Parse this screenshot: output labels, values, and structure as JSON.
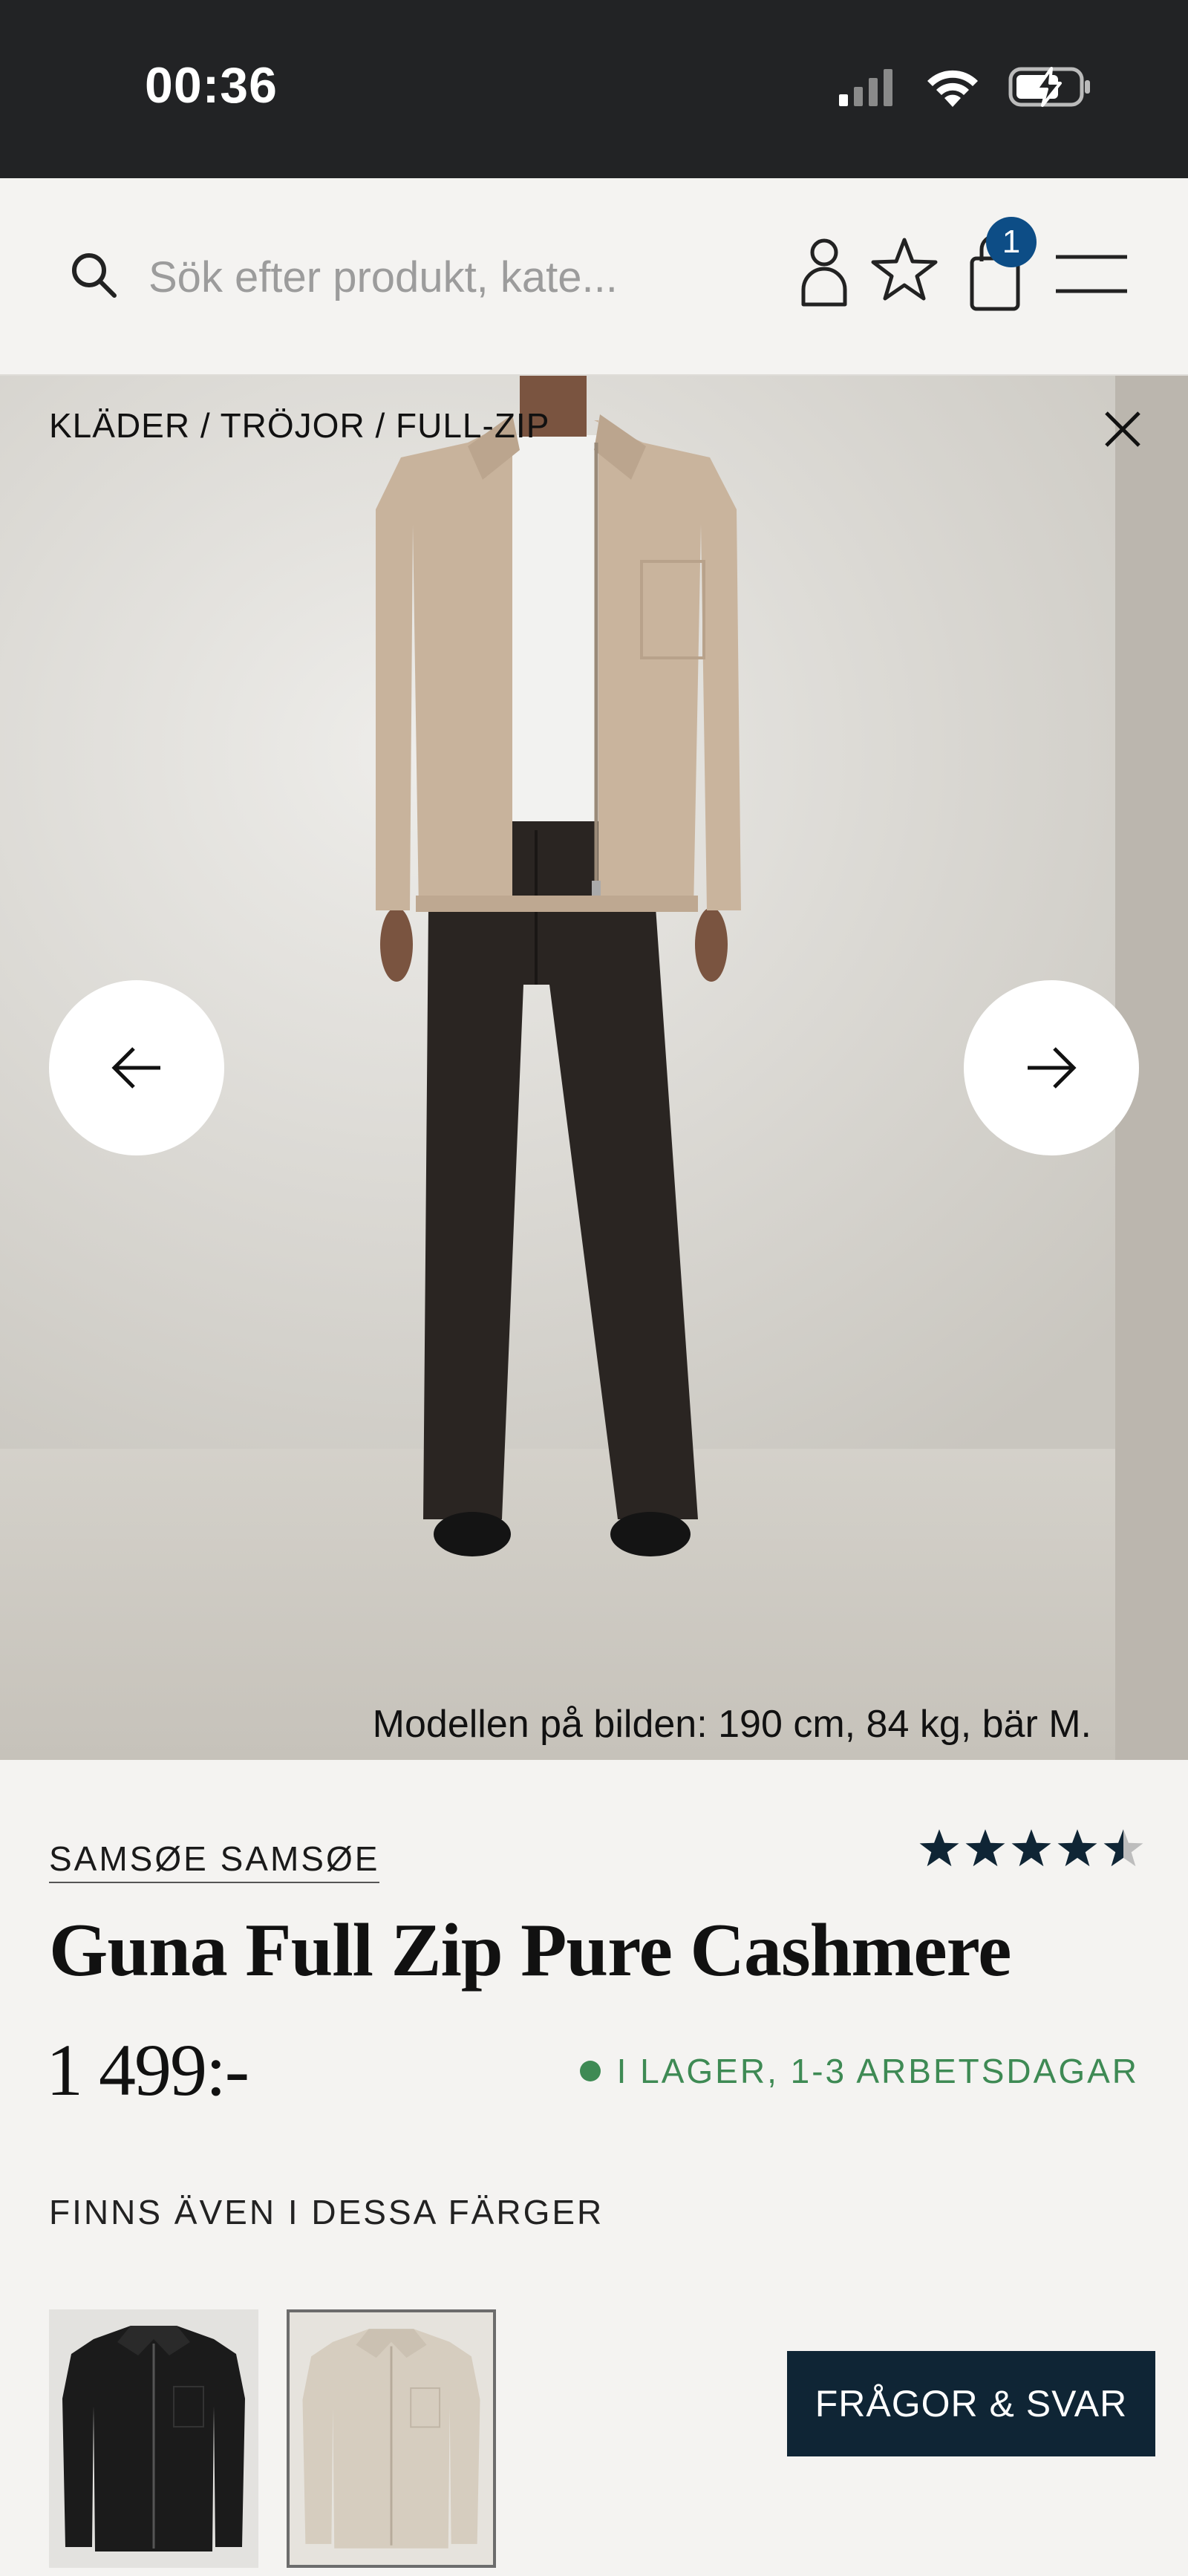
{
  "status_bar": {
    "time": "00:36",
    "icons": [
      "cellular-signal-icon",
      "wifi-icon",
      "battery-charging-icon"
    ]
  },
  "header": {
    "search_placeholder": "Sök efter produkt, kate...",
    "cart_count": "1",
    "icons": [
      "search-icon",
      "account-icon",
      "wishlist-star-icon",
      "shopping-bag-icon",
      "menu-icon"
    ],
    "badge_color": "#0d4d86"
  },
  "hero": {
    "breadcrumb": "KLÄDER / TRÖJOR / FULL-ZIP",
    "model_caption": "Modellen på bilden: 190 cm, 84 kg, bär M."
  },
  "product": {
    "brand": "SAMSØE SAMSØE",
    "title": "Guna Full Zip Pure Cashmere",
    "price": "1 499:-",
    "rating": 4.5,
    "stock_status": "I LAGER, 1-3 ARBETSDAGAR",
    "stock_color": "#3e8a54"
  },
  "colors": {
    "heading": "FINNS ÄVEN I DESSA FÄRGER",
    "swatches": [
      "black",
      "beige"
    ]
  },
  "faq_button": "FRÅGOR & SVAR",
  "accent_color": "#0f2535"
}
